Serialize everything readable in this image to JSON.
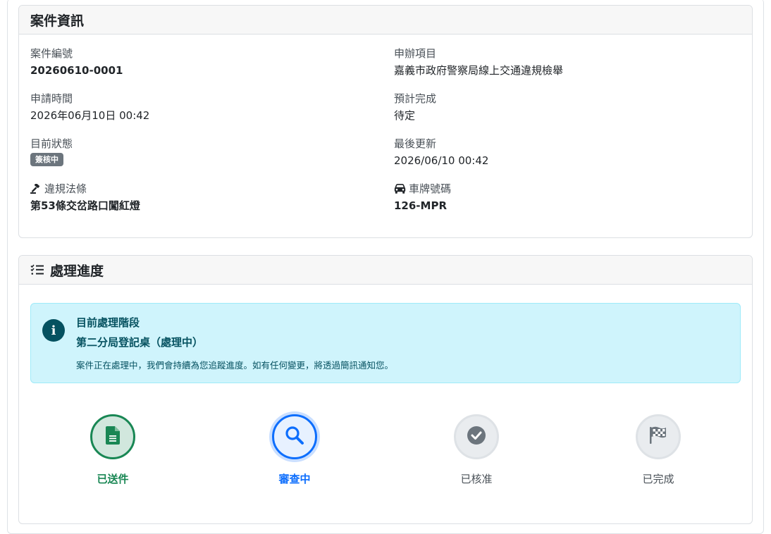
{
  "case_info": {
    "header": "案件資訊",
    "fields": {
      "case_no": {
        "label": "案件編號",
        "value": "20260610-0001"
      },
      "service": {
        "label": "申辦項目",
        "value": "嘉義市政府警察局線上交通違規檢舉"
      },
      "apply_time": {
        "label": "申請時間",
        "value": "2026年06月10日 00:42"
      },
      "expected": {
        "label": "預計完成",
        "value": "待定"
      },
      "status": {
        "label": "目前狀態",
        "value": "簽核中"
      },
      "updated": {
        "label": "最後更新",
        "value": "2026/06/10 00:42"
      },
      "violation": {
        "label": "違規法條",
        "value": "第53條交岔路口闖紅燈",
        "icon": "gavel-icon"
      },
      "plate": {
        "label": "車牌號碼",
        "value": "126-MPR",
        "icon": "car-icon"
      }
    }
  },
  "progress": {
    "header": "處理進度",
    "header_icon": "list-check-icon",
    "alert": {
      "title": "目前處理階段",
      "stage": "第二分局登記桌（處理中）",
      "text": "案件正在處理中，我們會持續為您追蹤進度。如有任何變更，將透過簡訊通知您。",
      "icon": "info-icon"
    },
    "steps": [
      {
        "label": "已送件",
        "state": "done",
        "icon": "file-icon"
      },
      {
        "label": "審查中",
        "state": "active",
        "icon": "search-icon"
      },
      {
        "label": "已核准",
        "state": "todo",
        "icon": "check-circle-icon"
      },
      {
        "label": "已完成",
        "state": "todo",
        "icon": "flag-checkered-icon"
      }
    ]
  },
  "colors": {
    "success": "#198754",
    "primary": "#0d6efd",
    "muted": "#6c757d",
    "info_bg": "#cff4fc",
    "info_text": "#055160"
  }
}
